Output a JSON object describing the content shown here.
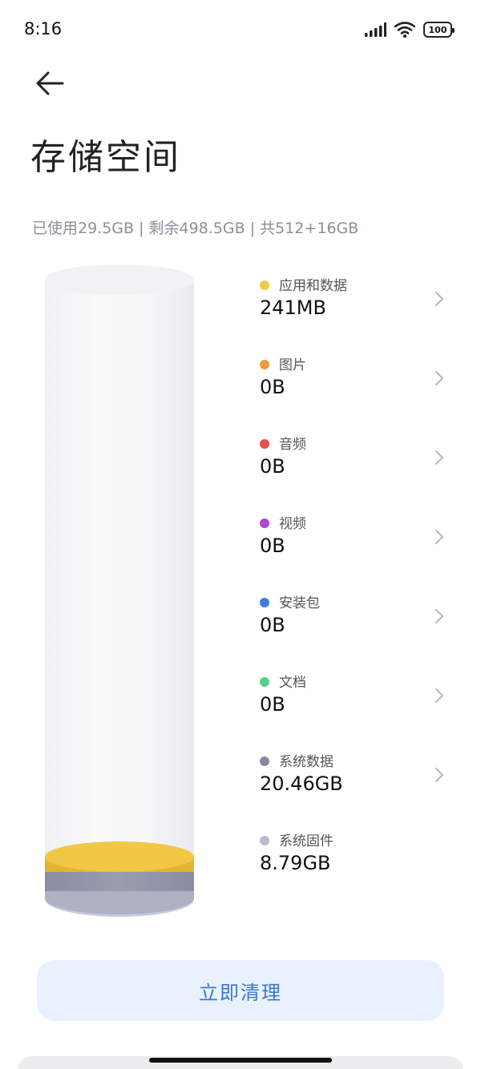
{
  "status_bar": {
    "time": "8:16",
    "battery": "100"
  },
  "header": {
    "title": "存储空间",
    "summary": "已使用29.5GB | 剩余498.5GB | 共512+16GB"
  },
  "categories": [
    {
      "label": "应用和数据",
      "value": "241MB",
      "color": "#f0c846",
      "has_chevron": true
    },
    {
      "label": "图片",
      "value": "0B",
      "color": "#ef9a3e",
      "has_chevron": true
    },
    {
      "label": "音频",
      "value": "0B",
      "color": "#e6514b",
      "has_chevron": true
    },
    {
      "label": "视频",
      "value": "0B",
      "color": "#b148d2",
      "has_chevron": true
    },
    {
      "label": "安装包",
      "value": "0B",
      "color": "#3d7be0",
      "has_chevron": true
    },
    {
      "label": "文档",
      "value": "0B",
      "color": "#57d08a",
      "has_chevron": true
    },
    {
      "label": "系统数据",
      "value": "20.46GB",
      "color": "#868a9e",
      "has_chevron": true
    },
    {
      "label": "系统固件",
      "value": "8.79GB",
      "color": "#b8bbd0",
      "has_chevron": false
    }
  ],
  "actions": {
    "clean_label": "立即清理"
  },
  "icons": {
    "back": "arrow-left-icon",
    "chevron": "chevron-right-icon",
    "signal": "signal-icon",
    "wifi": "wifi-icon",
    "battery": "battery-icon"
  }
}
